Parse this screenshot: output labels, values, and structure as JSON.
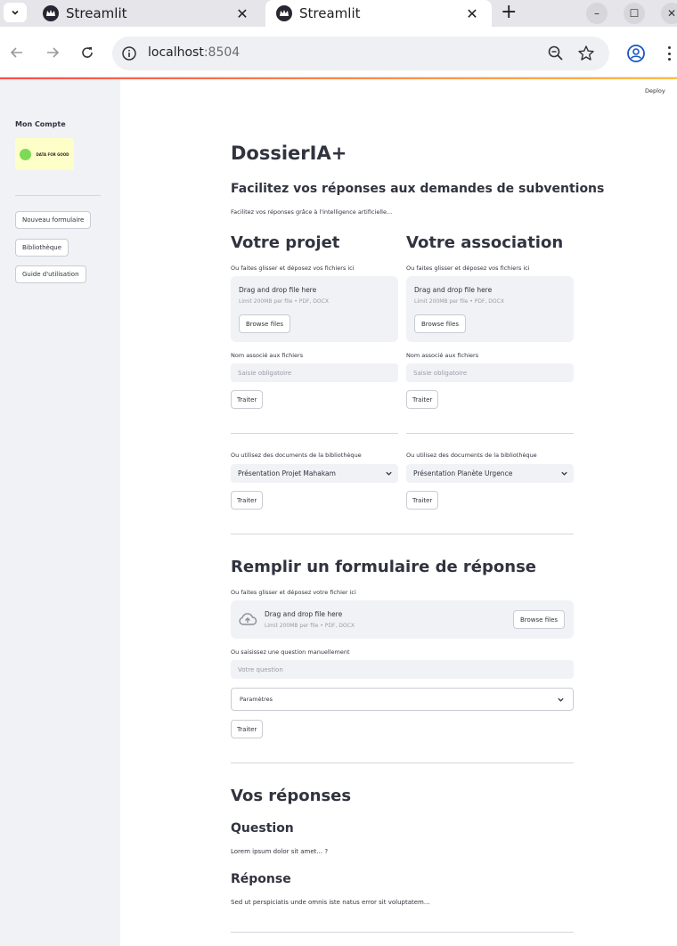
{
  "browser": {
    "tabs": [
      {
        "title": "Streamlit"
      },
      {
        "title": "Streamlit"
      }
    ],
    "url_host": "localhost",
    "url_port": ":8504"
  },
  "sidebar": {
    "title": "Mon Compte",
    "logo_text": "DATA FOR GOOD",
    "buttons": [
      "Nouveau formulaire",
      "Bibliothèque",
      "Guide d'utilisation"
    ]
  },
  "header": {
    "deploy": "Deploy"
  },
  "main": {
    "title": "DossierIA+",
    "subtitle": "Facilitez vos réponses aux demandes de subventions",
    "caption": "Facilitez vos réponses grâce à l'intelligence artificielle...",
    "projet": {
      "heading": "Votre projet",
      "upload_label": "Ou faites glisser et déposez vos fichiers ici",
      "drop_title": "Drag and drop file here",
      "drop_limit": "Limit 200MB per file • PDF, DOCX",
      "browse": "Browse files",
      "name_label": "Nom associé aux fichiers",
      "name_placeholder": "Saisie obligatoire",
      "process": "Traiter",
      "library_label": "Ou utilisez des documents de la bibliothèque",
      "library_value": "Présentation Projet Mahakam",
      "process2": "Traiter"
    },
    "association": {
      "heading": "Votre association",
      "upload_label": "Ou faites glisser et déposez vos fichiers ici",
      "drop_title": "Drag and drop file here",
      "drop_limit": "Limit 200MB per file • PDF, DOCX",
      "browse": "Browse files",
      "name_label": "Nom associé aux fichiers",
      "name_placeholder": "Saisie obligatoire",
      "process": "Traiter",
      "library_label": "Ou utilisez des documents de la bibliothèque",
      "library_value": "Présentation Planète Urgence",
      "process2": "Traiter"
    },
    "formulaire": {
      "heading": "Remplir un formulaire de réponse",
      "upload_label": "Ou faites glisser et déposez votre fichier ici",
      "drop_title": "Drag and drop file here",
      "drop_limit": "Limit 200MB per file • PDF, DOCX",
      "browse": "Browse files",
      "question_label": "Ou saisissez une question manuellement",
      "question_placeholder": "Votre question",
      "params": "Paramètres",
      "process": "Traiter"
    },
    "reponses": {
      "heading": "Vos réponses",
      "question_heading": "Question",
      "question_text": "Lorem ipsum dolor sit amet... ?",
      "answer_heading": "Réponse",
      "answer_text": "Sed ut perspiciatis unde omnis iste natus error sit voluptatem..."
    }
  }
}
